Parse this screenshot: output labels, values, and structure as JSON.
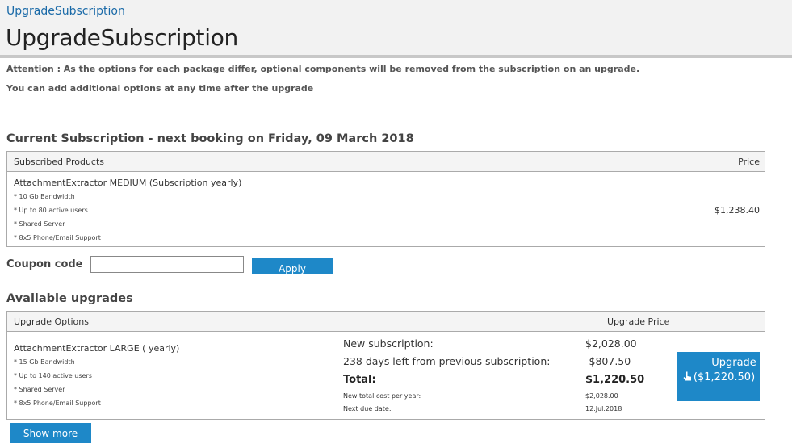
{
  "header": {
    "breadcrumb": "UpgradeSubscription",
    "title": "UpgradeSubscription"
  },
  "notices": [
    "Attention : As the options for each package differ, optional components will be removed from the subscription on an upgrade.",
    "You can add additional options at any time after the upgrade"
  ],
  "current": {
    "heading": "Current Subscription - next booking on Friday, 09 March 2018",
    "col_products": "Subscribed Products",
    "col_price": "Price",
    "product": "AttachmentExtractor MEDIUM (Subscription yearly)",
    "features": [
      "* 10 Gb Bandwidth",
      "* Up to 80 active users",
      "* Shared Server",
      "* 8x5 Phone/Email Support"
    ],
    "price": "$1,238.40"
  },
  "coupon": {
    "label": "Coupon code",
    "value": "",
    "apply_label": "Apply"
  },
  "available": {
    "heading": "Available upgrades",
    "col_options": "Upgrade Options",
    "col_price": "Upgrade Price",
    "product": "AttachmentExtractor LARGE ( yearly)",
    "features": [
      "* 15 Gb Bandwidth",
      "* Up to 140 active users",
      "* Shared Server",
      "* 8x5 Phone/Email Support"
    ],
    "new_subscription_label": "New subscription:",
    "new_subscription_value": "$2,028.00",
    "days_left_label": "238 days left from previous subscription:",
    "days_left_value": "-$807.50",
    "total_label": "Total:",
    "total_value": "$1,220.50",
    "yearly_label": "New total cost per year:",
    "yearly_value": "$2,028.00",
    "due_label": "Next due date:",
    "due_value": "12.Jul.2018",
    "upgrade_label": "Upgrade",
    "upgrade_amount": "($1,220.50)"
  },
  "show_more_label": "Show more",
  "icons": {
    "upgrade": "hand-pointer-icon"
  }
}
